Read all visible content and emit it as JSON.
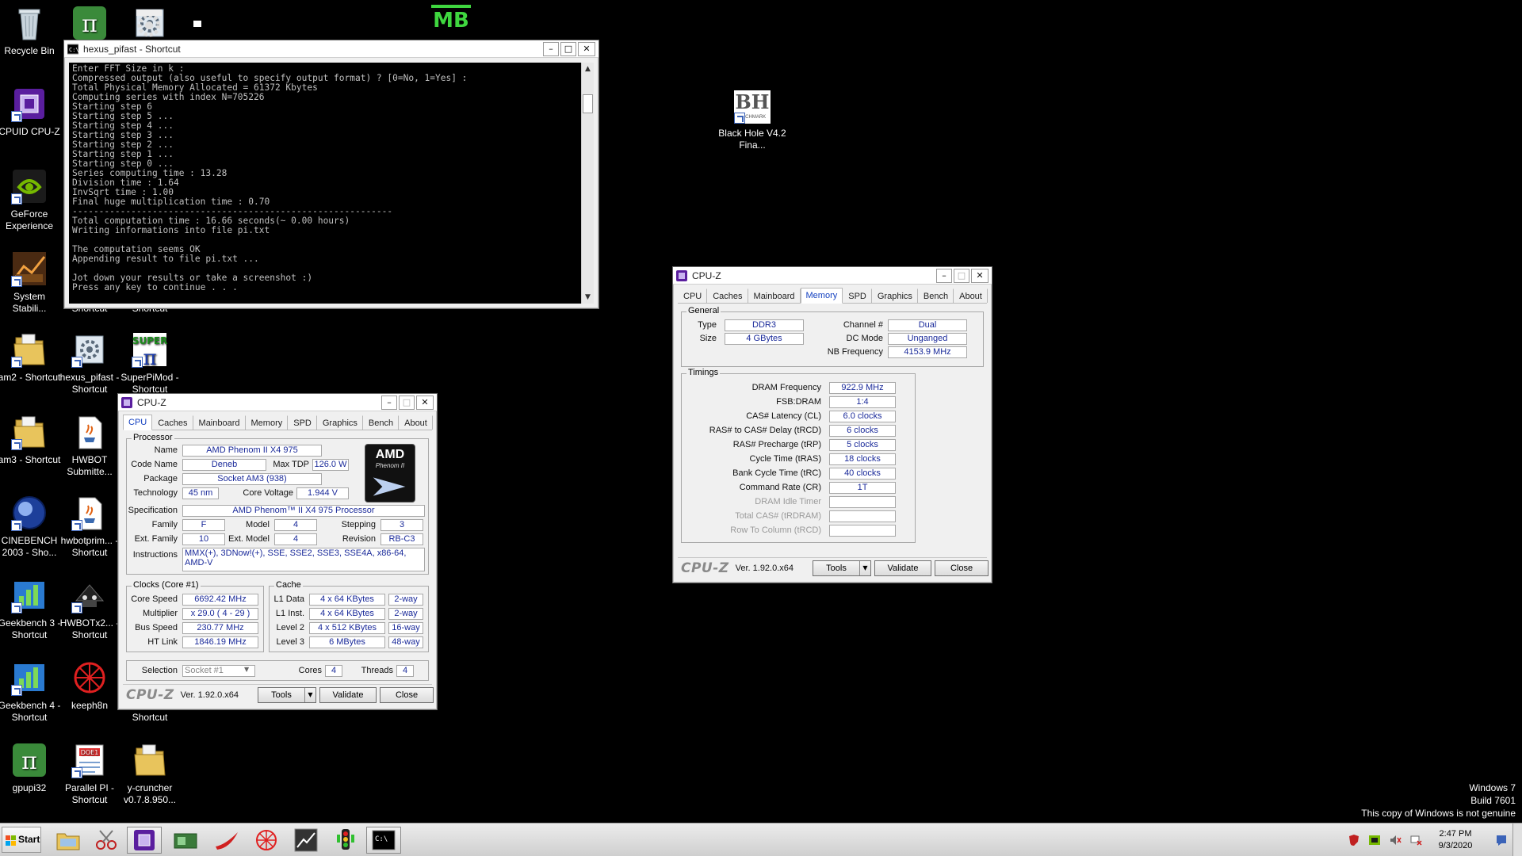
{
  "desktop": {
    "icons": [
      {
        "label": "Recycle Bin"
      },
      {
        "label": "CPUID CPU-Z"
      },
      {
        "label": "GeForce Experience"
      },
      {
        "label": "System Stabili..."
      },
      {
        "label": "am2 - Shortcut"
      },
      {
        "label": "am3 - Shortcut"
      },
      {
        "label": "CINEBENCH 2003 - Sho..."
      },
      {
        "label": "Geekbench 3 - Shortcut"
      },
      {
        "label": "Geekbench 4 - Shortcut"
      },
      {
        "label": "gpupi32"
      },
      {
        "label": "Shortcut"
      },
      {
        "label": "Shortcut"
      },
      {
        "label": "hexus_pifast - Shortcut"
      },
      {
        "label": "HWBOT Submitte..."
      },
      {
        "label": "hwbotprim... - Shortcut"
      },
      {
        "label": "HWBOTx2... - Shortcut"
      },
      {
        "label": "keeph8n"
      },
      {
        "label": "Parallel PI - Shortcut"
      },
      {
        "label": "SuperPiMod - Shortcut"
      },
      {
        "label": "Shortcut"
      },
      {
        "label": "y-cruncher v0.7.8.950..."
      },
      {
        "label": "Black Hole V4.2 Fina..."
      }
    ],
    "bh_text": "BH",
    "bh_sub": "ENCHMARK",
    "mb_text": "MB",
    "parallel_badge": "DOE1",
    "super_text": "SUPER",
    "watermark": [
      "Windows 7",
      "Build 7601",
      "This copy of Windows is not genuine"
    ]
  },
  "console": {
    "title": "hexus_pifast - Shortcut",
    "lines": [
      "Enter FFT Size in k :",
      "Compressed output (also useful to specify output format) ? [0=No, 1=Yes] :",
      "Total Physical Memory Allocated = 61372 Kbytes",
      "Computing series with index N=705226",
      "Starting step 6",
      "Starting step 5 ...",
      "Starting step 4 ...",
      "Starting step 3 ...",
      "Starting step 2 ...",
      "Starting step 1 ...",
      "Starting step 0 ...",
      "Series computing time : 13.28",
      "Division time : 1.64",
      "InvSqrt time : 1.00",
      "Final huge multiplication time : 0.70",
      "------------------------------------------------------------",
      "Total computation time : 16.66 seconds(~ 0.00 hours)",
      "Writing informations into file pi.txt",
      "",
      "The computation seems OK",
      "Appending result to file pi.txt ...",
      "",
      "Jot down your results or take a screenshot :)",
      "Press any key to continue . . ."
    ]
  },
  "cpuz_cpu": {
    "title": "CPU-Z",
    "tabs": [
      "CPU",
      "Caches",
      "Mainboard",
      "Memory",
      "SPD",
      "Graphics",
      "Bench",
      "About"
    ],
    "active_tab": 0,
    "processor_label": "Processor",
    "labels": {
      "name": "Name",
      "code_name": "Code Name",
      "max_tdp": "Max TDP",
      "package": "Package",
      "technology": "Technology",
      "core_voltage": "Core Voltage",
      "specification": "Specification",
      "family": "Family",
      "model": "Model",
      "stepping": "Stepping",
      "ext_family": "Ext. Family",
      "ext_model": "Ext. Model",
      "revision": "Revision",
      "instructions": "Instructions"
    },
    "values": {
      "name": "AMD Phenom II X4 975",
      "code_name": "Deneb",
      "max_tdp": "126.0 W",
      "package": "Socket AM3 (938)",
      "technology": "45 nm",
      "core_voltage": "1.944 V",
      "specification": "AMD Phenom™ II X4 975 Processor",
      "family": "F",
      "model": "4",
      "stepping": "3",
      "ext_family": "10",
      "ext_model": "4",
      "revision": "RB-C3",
      "instructions": "MMX(+), 3DNow!(+), SSE, SSE2, SSE3, SSE4A, x86-64, AMD-V"
    },
    "logo_text": "AMD",
    "logo_sub": "Phenom II",
    "clocks": {
      "title": "Clocks (Core #1)",
      "labels": [
        "Core Speed",
        "Multiplier",
        "Bus Speed",
        "HT Link"
      ],
      "values": [
        "6692.42 MHz",
        "x 29.0 ( 4 - 29 )",
        "230.77 MHz",
        "1846.19 MHz"
      ]
    },
    "cache": {
      "title": "Cache",
      "labels": [
        "L1 Data",
        "L1 Inst.",
        "Level 2",
        "Level 3"
      ],
      "sizes": [
        "4 x 64 KBytes",
        "4 x 64 KBytes",
        "4 x 512 KBytes",
        "6 MBytes"
      ],
      "ways": [
        "2-way",
        "2-way",
        "16-way",
        "48-way"
      ]
    },
    "selection_label": "Selection",
    "selection_value": "Socket #1",
    "cores_label": "Cores",
    "cores_value": "4",
    "threads_label": "Threads",
    "threads_value": "4",
    "brand": "CPU-Z",
    "version": "Ver. 1.92.0.x64",
    "tools": "Tools",
    "validate": "Validate",
    "close": "Close"
  },
  "cpuz_mem": {
    "title": "CPU-Z",
    "tabs": [
      "CPU",
      "Caches",
      "Mainboard",
      "Memory",
      "SPD",
      "Graphics",
      "Bench",
      "About"
    ],
    "active_tab": 3,
    "general_title": "General",
    "type_label": "Type",
    "type_value": "DDR3",
    "size_label": "Size",
    "size_value": "4 GBytes",
    "channel_label": "Channel #",
    "channel_value": "Dual",
    "dcmode_label": "DC Mode",
    "dcmode_value": "Unganged",
    "nbfreq_label": "NB Frequency",
    "nbfreq_value": "4153.9 MHz",
    "timings_title": "Timings",
    "timings": [
      {
        "label": "DRAM Frequency",
        "value": "922.9 MHz"
      },
      {
        "label": "FSB:DRAM",
        "value": "1:4"
      },
      {
        "label": "CAS# Latency (CL)",
        "value": "6.0 clocks"
      },
      {
        "label": "RAS# to CAS# Delay (tRCD)",
        "value": "6 clocks"
      },
      {
        "label": "RAS# Precharge (tRP)",
        "value": "5 clocks"
      },
      {
        "label": "Cycle Time (tRAS)",
        "value": "18 clocks"
      },
      {
        "label": "Bank Cycle Time (tRC)",
        "value": "40 clocks"
      },
      {
        "label": "Command Rate (CR)",
        "value": "1T"
      },
      {
        "label": "DRAM Idle Timer",
        "value": ""
      },
      {
        "label": "Total CAS# (tRDRAM)",
        "value": ""
      },
      {
        "label": "Row To Column (tRCD)",
        "value": ""
      }
    ],
    "brand": "CPU-Z",
    "version": "Ver. 1.92.0.x64",
    "tools": "Tools",
    "validate": "Validate",
    "close": "Close"
  },
  "taskbar": {
    "start_label": "Start",
    "time": "2:47 PM",
    "date": "9/3/2020"
  }
}
